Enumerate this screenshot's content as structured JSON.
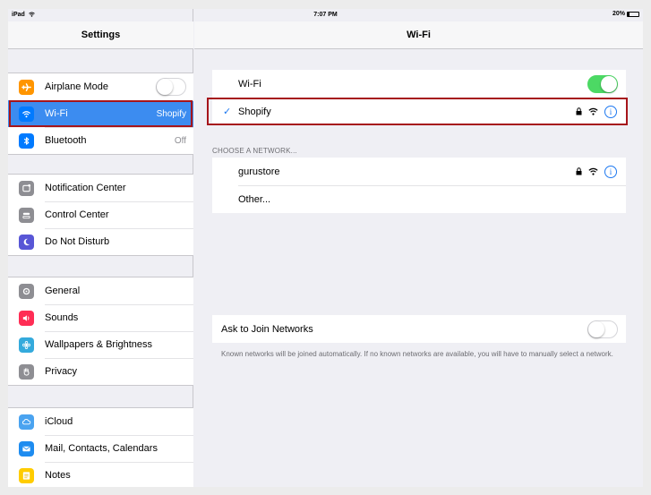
{
  "status_bar": {
    "device": "iPad",
    "time": "7:07 PM",
    "battery": "20%",
    "battery_fraction": 0.2
  },
  "master": {
    "title": "Settings",
    "groups": [
      [
        {
          "label": "Airplane Mode",
          "icon": "airplane-icon",
          "color": "#ff9500",
          "toggle": false
        },
        {
          "label": "Wi-Fi",
          "icon": "wifi-icon",
          "color": "#007aff",
          "value": "Shopify",
          "selected": true
        },
        {
          "label": "Bluetooth",
          "icon": "bluetooth-icon",
          "color": "#007aff",
          "value": "Off"
        }
      ],
      [
        {
          "label": "Notification Center",
          "icon": "notification-center-icon",
          "color": "#8e8e93"
        },
        {
          "label": "Control Center",
          "icon": "control-center-icon",
          "color": "#8e8e93"
        },
        {
          "label": "Do Not Disturb",
          "icon": "moon-icon",
          "color": "#5856d6"
        }
      ],
      [
        {
          "label": "General",
          "icon": "gear-icon",
          "color": "#8e8e93"
        },
        {
          "label": "Sounds",
          "icon": "speaker-icon",
          "color": "#ff2d55"
        },
        {
          "label": "Wallpapers & Brightness",
          "icon": "flower-icon",
          "color": "#34aadc"
        },
        {
          "label": "Privacy",
          "icon": "hand-icon",
          "color": "#8e8e93"
        }
      ],
      [
        {
          "label": "iCloud",
          "icon": "cloud-icon",
          "color": "#4aa3f0"
        },
        {
          "label": "Mail, Contacts, Calendars",
          "icon": "mail-icon",
          "color": "#1e8cf0"
        },
        {
          "label": "Notes",
          "icon": "notes-icon",
          "color": "#ffcc00"
        }
      ]
    ]
  },
  "detail": {
    "title": "Wi-Fi",
    "wifi_row": {
      "label": "Wi-Fi",
      "toggle": true
    },
    "connected": {
      "label": "Shopify",
      "check": "✓",
      "info": "i"
    },
    "section_label": "CHOOSE A NETWORK...",
    "networks": [
      {
        "label": "gurustore",
        "info": "i"
      },
      {
        "label": "Other..."
      }
    ],
    "ask_row": {
      "label": "Ask to Join Networks",
      "toggle": false
    },
    "footnote": "Known networks will be joined automatically. If no known networks are available, you will have to manually select a network."
  }
}
